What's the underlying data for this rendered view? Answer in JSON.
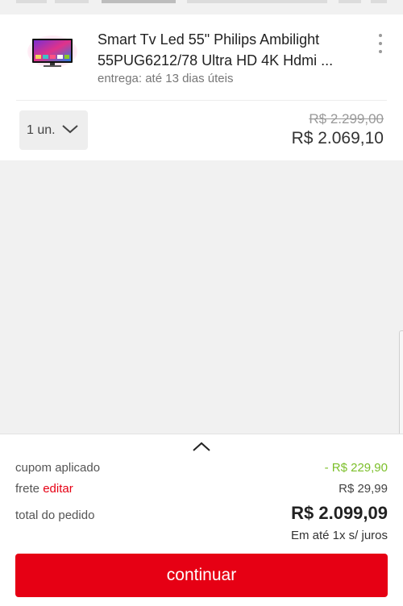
{
  "product": {
    "title": "Smart Tv Led 55\" Philips Ambilight 55PUG6212/78 Ultra HD 4K Hdmi ...",
    "delivery": "entrega: até 13 dias úteis",
    "image_icon": "tv-thumbnail"
  },
  "quantity": {
    "label": "1 un."
  },
  "price": {
    "old": "R$ 2.299,00",
    "current": "R$ 2.069,10"
  },
  "summary": {
    "coupon_label": "cupom aplicado",
    "coupon_value": "- R$ 229,90",
    "shipping_label": "frete",
    "shipping_edit": "editar",
    "shipping_value": "R$ 29,99",
    "total_label": "total do pedido",
    "total_value": "R$ 2.099,09",
    "installments": "Em até 1x s/ juros",
    "continue_label": "continuar"
  },
  "colors": {
    "accent": "#e60014",
    "discount": "#7cbf2a"
  }
}
